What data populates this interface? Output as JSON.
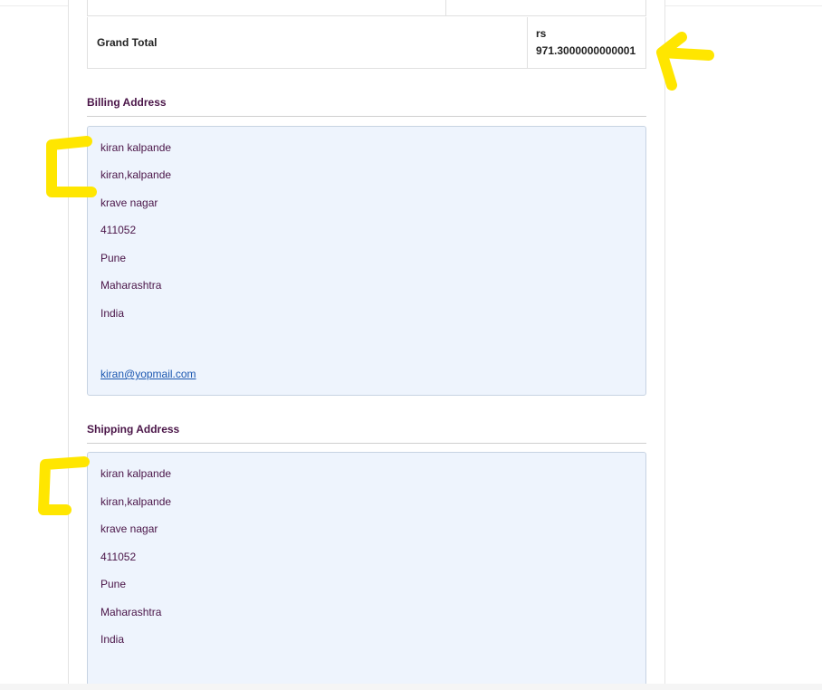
{
  "order_totals": {
    "grand_total_label": "Grand Total",
    "grand_total_currency": "rs",
    "grand_total_amount": "971.3000000000001"
  },
  "billing": {
    "title": "Billing Address",
    "lines": [
      "kiran kalpande",
      "kiran,kalpande",
      "krave nagar",
      "411052",
      "Pune",
      "Maharashtra",
      "India"
    ],
    "email": "kiran@yopmail.com"
  },
  "shipping": {
    "title": "Shipping Address",
    "lines": [
      "kiran kalpande",
      "kiran,kalpande",
      "krave nagar",
      "411052",
      "Pune",
      "Maharashtra",
      "India"
    ]
  },
  "annotations": {
    "highlight_color": "#ffe600",
    "marks": [
      "arrow-left",
      "bracket",
      "bracket"
    ]
  }
}
